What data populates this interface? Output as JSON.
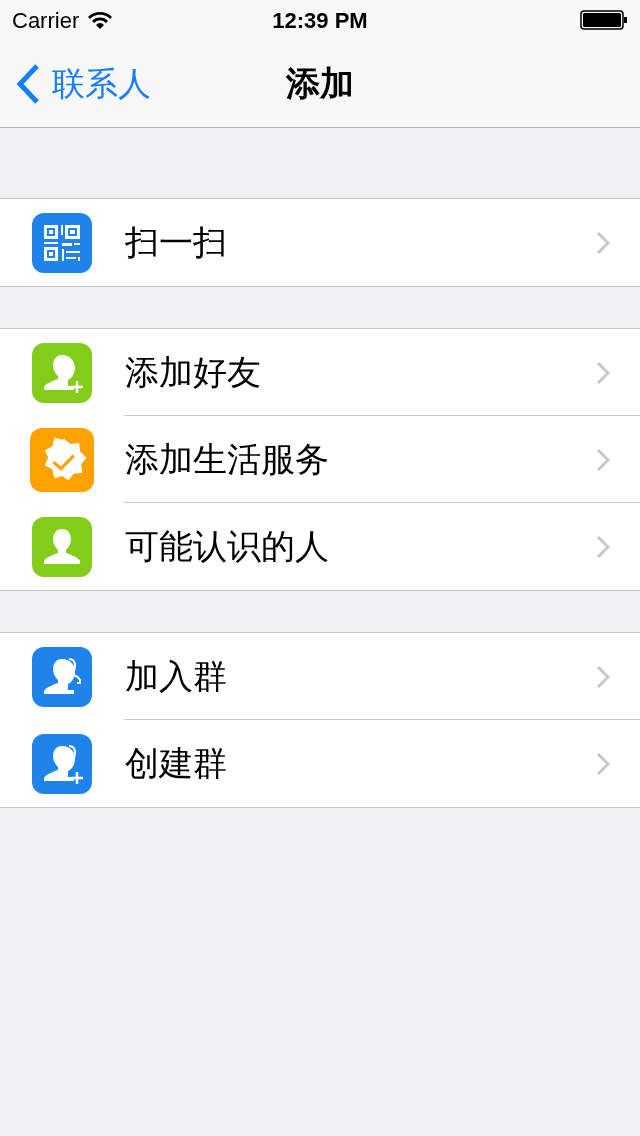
{
  "status_bar": {
    "carrier": "Carrier",
    "time": "12:39 PM"
  },
  "nav_bar": {
    "back": "联系人",
    "title": "添加"
  },
  "sections": [
    {
      "items": [
        {
          "kind": "qr",
          "color": "#1e84ec",
          "label": "扫一扫"
        }
      ]
    },
    {
      "items": [
        {
          "kind": "person-add",
          "color": "#83cd1a",
          "label": "添加好友"
        },
        {
          "kind": "badge",
          "color": "#ffa200",
          "label": "添加生活服务"
        },
        {
          "kind": "person",
          "color": "#83cd1a",
          "label": "可能认识的人"
        }
      ]
    },
    {
      "items": [
        {
          "kind": "group",
          "color": "#1e84ec",
          "label": "加入群"
        },
        {
          "kind": "group-add",
          "color": "#1e84ec",
          "label": "创建群"
        }
      ]
    }
  ]
}
